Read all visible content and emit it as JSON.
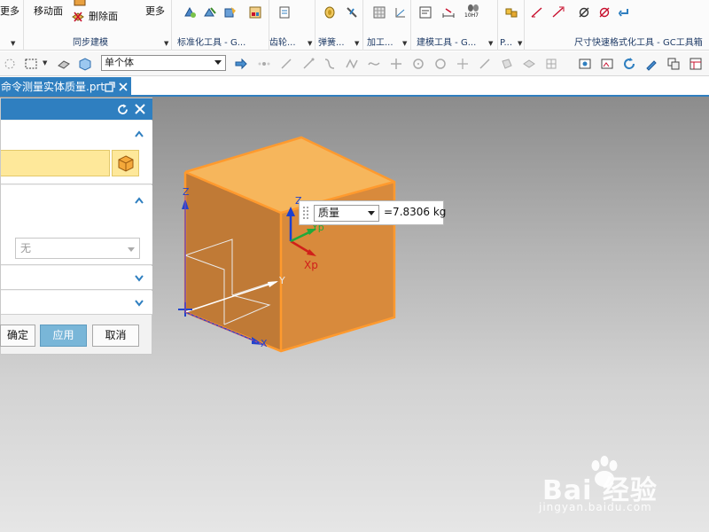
{
  "ribbon": {
    "more_left_label": "更多",
    "move_face_label": "移动面",
    "top_cut_label": "",
    "delete_face_label": "删除面",
    "more_label": "更多",
    "groups": [
      {
        "label": "同步建模"
      },
      {
        "label": "标准化工具 - G..."
      },
      {
        "label": "齿轮..."
      },
      {
        "label": "弹簧..."
      },
      {
        "label": "加工..."
      },
      {
        "label": "建模工具 - G..."
      },
      {
        "label": "P..."
      },
      {
        "label": "尺寸快速格式化工具 - GC工具箱"
      }
    ],
    "icon_text_10h7": "10H7"
  },
  "toolbar": {
    "selection_filter": "单个体"
  },
  "tab": {
    "title": "命令测量实体质量.prt"
  },
  "dialog": {
    "combo_value": "无",
    "ok_label": "确定",
    "apply_label": "应用",
    "cancel_label": "取消"
  },
  "measurement": {
    "type": "质量",
    "value": "=7.8306 kg"
  },
  "axes": {
    "zc": "Z",
    "yc": "Y",
    "xc": "X",
    "yp": "Yp",
    "xp": "Xp"
  },
  "watermark": {
    "brand": "Bai 经验",
    "url": "jingyan.baidu.com"
  },
  "colors": {
    "accent": "#2f7fc0",
    "selection": "#fee89a",
    "cube_face": "#d88a3c",
    "cube_top": "#f6b65c",
    "cube_edge": "#ff9a2e"
  }
}
